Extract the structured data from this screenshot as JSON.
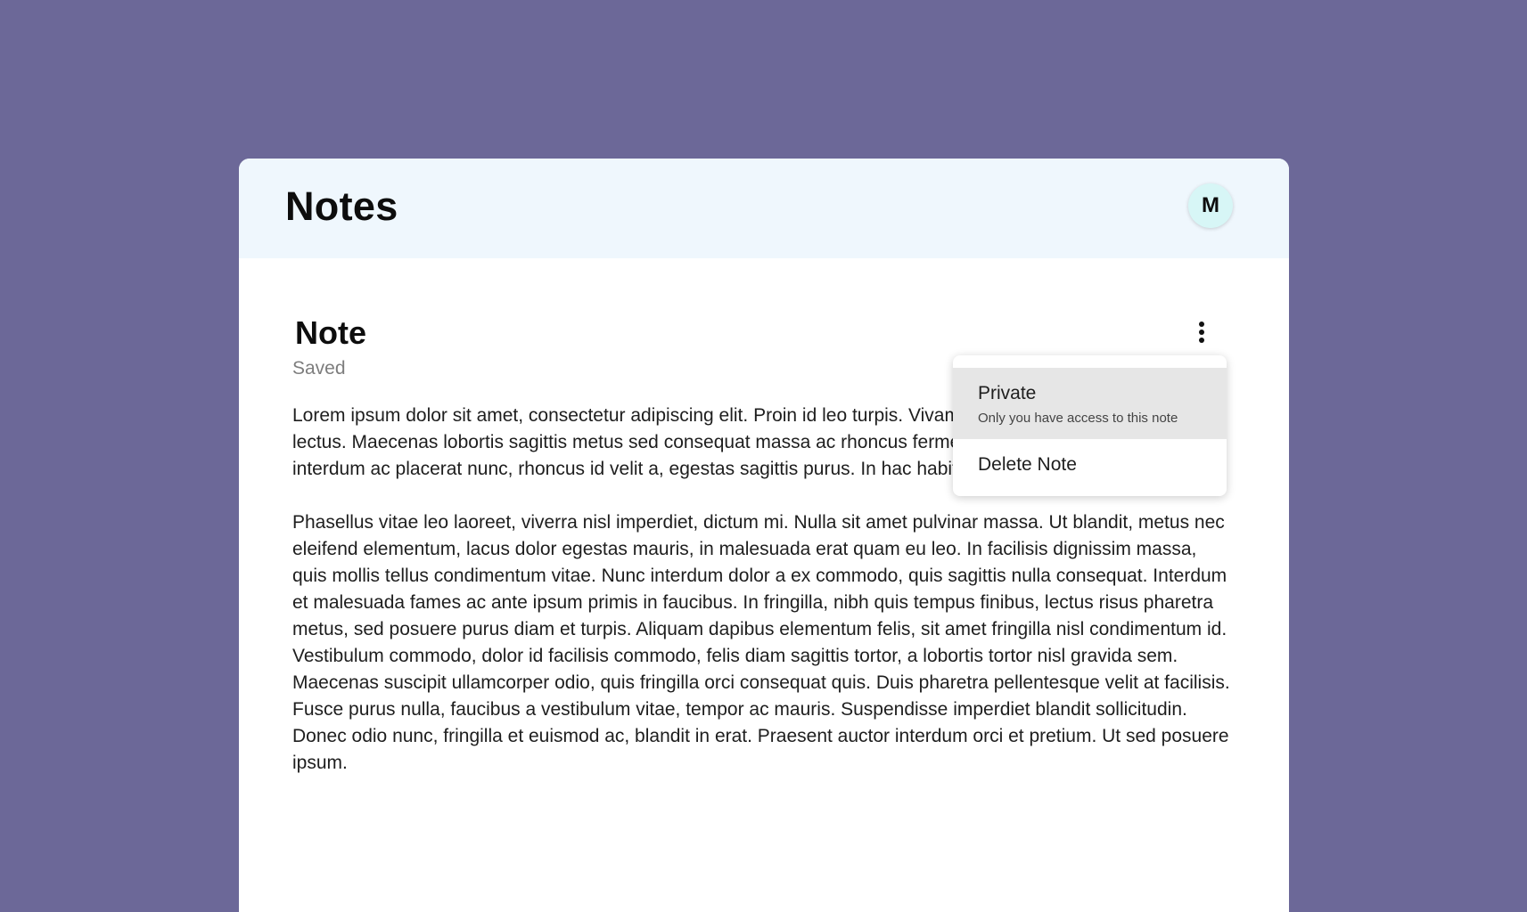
{
  "header": {
    "title": "Notes",
    "avatar_initial": "M"
  },
  "note": {
    "title": "Note",
    "status": "Saved",
    "paragraphs": [
      "Lorem ipsum dolor sit amet, consectetur adipiscing elit. Proin id leo turpis. Vivamus erat at, sodales vulputate lectus. Maecenas lobortis sagittis metus sed consequat massa ac rhoncus fermentum. Curabitur tortor augue, interdum ac placerat nunc, rhoncus id velit a, egestas sagittis purus. In hac habitasse platea dictumst.",
      "Phasellus vitae leo laoreet, viverra nisl imperdiet, dictum mi. Nulla sit amet pulvinar massa. Ut blandit, metus nec eleifend elementum, lacus dolor egestas mauris, in malesuada erat quam eu leo. In facilisis dignissim massa, quis mollis tellus condimentum vitae. Nunc interdum dolor a ex commodo, quis sagittis nulla consequat. Interdum et malesuada fames ac ante ipsum primis in faucibus. In fringilla, nibh quis tempus finibus, lectus risus pharetra metus, sed posuere purus diam et turpis. Aliquam dapibus elementum felis, sit amet fringilla nisl condimentum id. Vestibulum commodo, dolor id facilisis commodo, felis diam sagittis tortor, a lobortis tortor nisl gravida sem. Maecenas suscipit ullamcorper odio, quis fringilla orci consequat quis. Duis pharetra pellentesque velit at facilisis. Fusce purus nulla, faucibus a vestibulum vitae, tempor ac mauris. Suspendisse imperdiet blandit sollicitudin. Donec odio nunc, fringilla et euismod ac, blandit in erat. Praesent auctor interdum orci et pretium. Ut sed posuere ipsum."
    ]
  },
  "menu": {
    "icon": "kebab-menu-icon",
    "items": [
      {
        "label": "Private",
        "description": "Only you have access to this note"
      },
      {
        "label": "Delete Note"
      }
    ]
  },
  "colors": {
    "background": "#6c6898",
    "header_bg": "#eff7fd",
    "avatar_bg": "#d7f6f6",
    "menu_highlight": "#e6e6e6"
  }
}
